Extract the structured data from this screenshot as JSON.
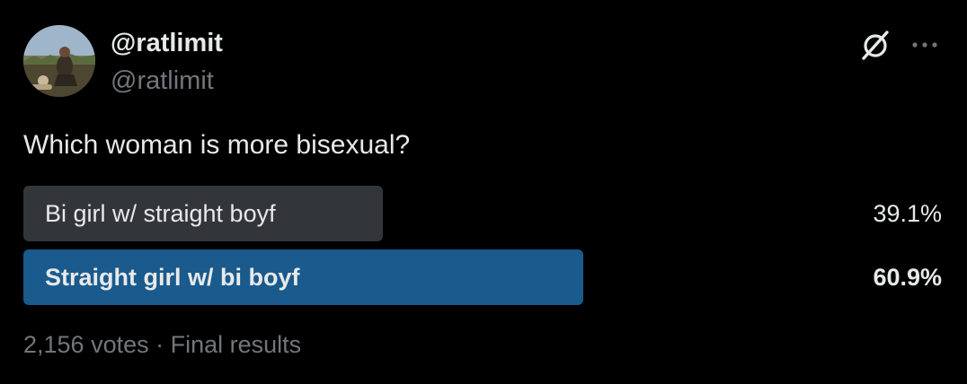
{
  "tweet": {
    "display_name": "@ratlimit",
    "handle": "@ratlimit",
    "avatar_icon": "user-avatar-photo",
    "grok_icon": "grok-slash-circle-icon",
    "more_icon": "more-options-icon",
    "question": "Which woman is more bisexual?"
  },
  "poll": {
    "options": [
      {
        "label": "Bi girl w/ straight boyf",
        "percent_text": "39.1%",
        "percent": 39.1,
        "winner": false,
        "bar_color": "#333639"
      },
      {
        "label": "Straight girl w/ bi boyf",
        "percent_text": "60.9%",
        "percent": 60.9,
        "winner": true,
        "bar_color": "#1a5a8c"
      }
    ],
    "footer": "2,156 votes · Final results"
  },
  "colors": {
    "background": "#000000",
    "primary_text": "#e7e9ea",
    "secondary_text": "#71767b",
    "loser_bar": "#333639",
    "winner_bar": "#1a5a8c"
  }
}
